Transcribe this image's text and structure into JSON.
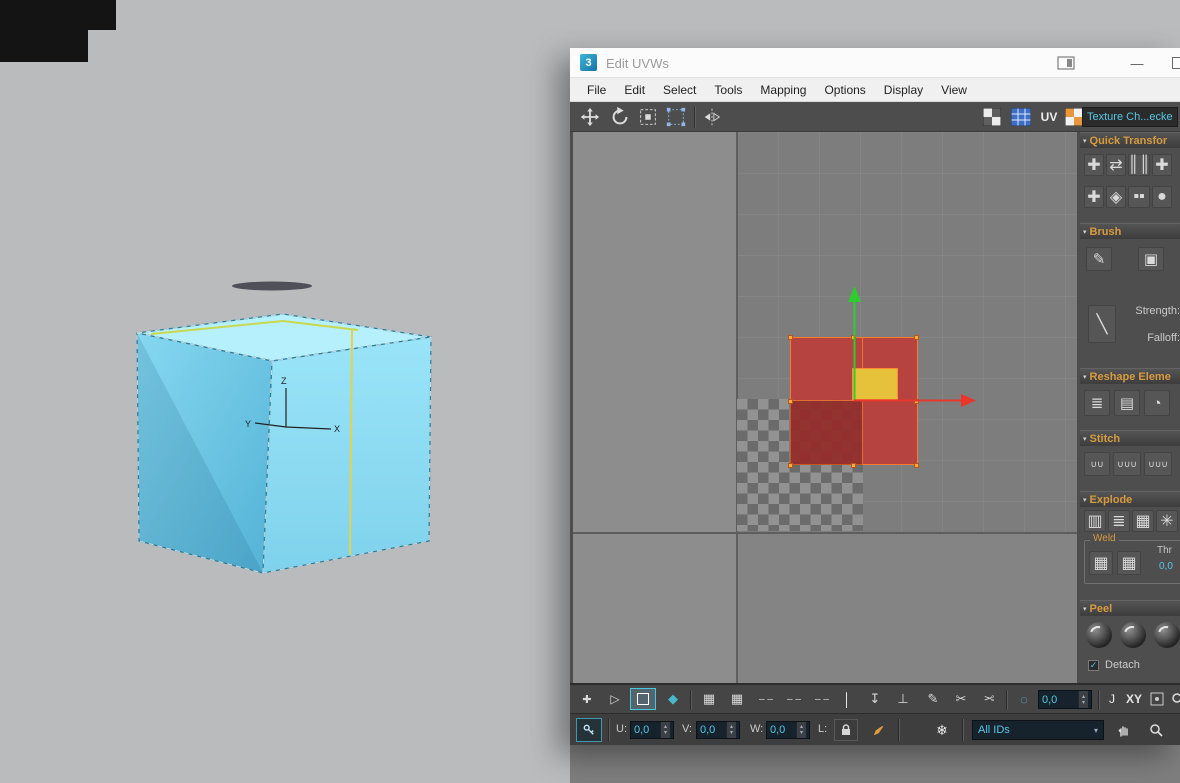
{
  "window": {
    "logo_text": "3",
    "title": "Edit UVWs",
    "minimize": "—",
    "menus": [
      "File",
      "Edit",
      "Select",
      "Tools",
      "Mapping",
      "Options",
      "Display",
      "View"
    ]
  },
  "toolbar": {
    "uv_label": "UV"
  },
  "panel": {
    "texture_select": "Texture Ch...ecke",
    "quick_transform_title": "Quick Transfor",
    "quick_icons": [
      "✚",
      "⇄",
      "║║",
      "✚",
      "✚",
      "◈",
      "▪▪",
      "●"
    ],
    "brush_title": "Brush",
    "brush_icons": [
      "✎",
      "▣"
    ],
    "falloff_icon": "╲",
    "brush_strength_label": "Strength:",
    "brush_falloff_label": "Falloff:",
    "reshape_title": "Reshape Eleme",
    "reshape_icons": [
      "≣",
      "▤",
      "◔"
    ],
    "stitch_title": "Stitch",
    "stitch_icons": [
      "∪∪",
      "∪∪∪",
      "∪∪∪"
    ],
    "explode_title": "Explode",
    "explode_icons": [
      "▥",
      "≣",
      "▦",
      "✳"
    ],
    "weld_label": "Weld",
    "weld_icons": [
      "▦",
      "▦"
    ],
    "weld_threshold_label": "Thr",
    "weld_threshold_value": "0,0",
    "peel_title": "Peel",
    "detach_label": "Detach",
    "detach_check": "✓"
  },
  "statusbar": {
    "g_plus": "✚",
    "g_triangle": "▷",
    "g_cube": "◆",
    "g_grid": "▦",
    "g_dashes": "– –",
    "g_vbar": "│",
    "g_down": "↧",
    "g_bottom": "⊥",
    "g_pencil": "✎",
    "g_scissors": "✂",
    "g_circle": "◌",
    "g_lasso": "J",
    "g_snow": "❄",
    "coord_value": "0,0",
    "xy_label": "XY",
    "u_label": "U:",
    "u_value": "0,0",
    "v_label": "V:",
    "v_value": "0,0",
    "w_label": "W:",
    "w_value": "0,0",
    "l_label": "L:",
    "ids_value": "All IDs",
    "spin_up": "▴",
    "spin_down": "▾",
    "dd_arrow": "▾"
  },
  "ui": {
    "tri_down": "▾"
  },
  "viewport": {
    "axis_x": "X",
    "axis_y": "Y",
    "axis_z": "Z"
  },
  "colors": {
    "accent_cyan": "#56c8e6",
    "header_orange": "#d79b3f",
    "shell_red": "#bb3e3a",
    "gizmo_green": "#2ecc2e",
    "gizmo_red": "#e8362a",
    "seam_yellow": "#e5d24b"
  }
}
